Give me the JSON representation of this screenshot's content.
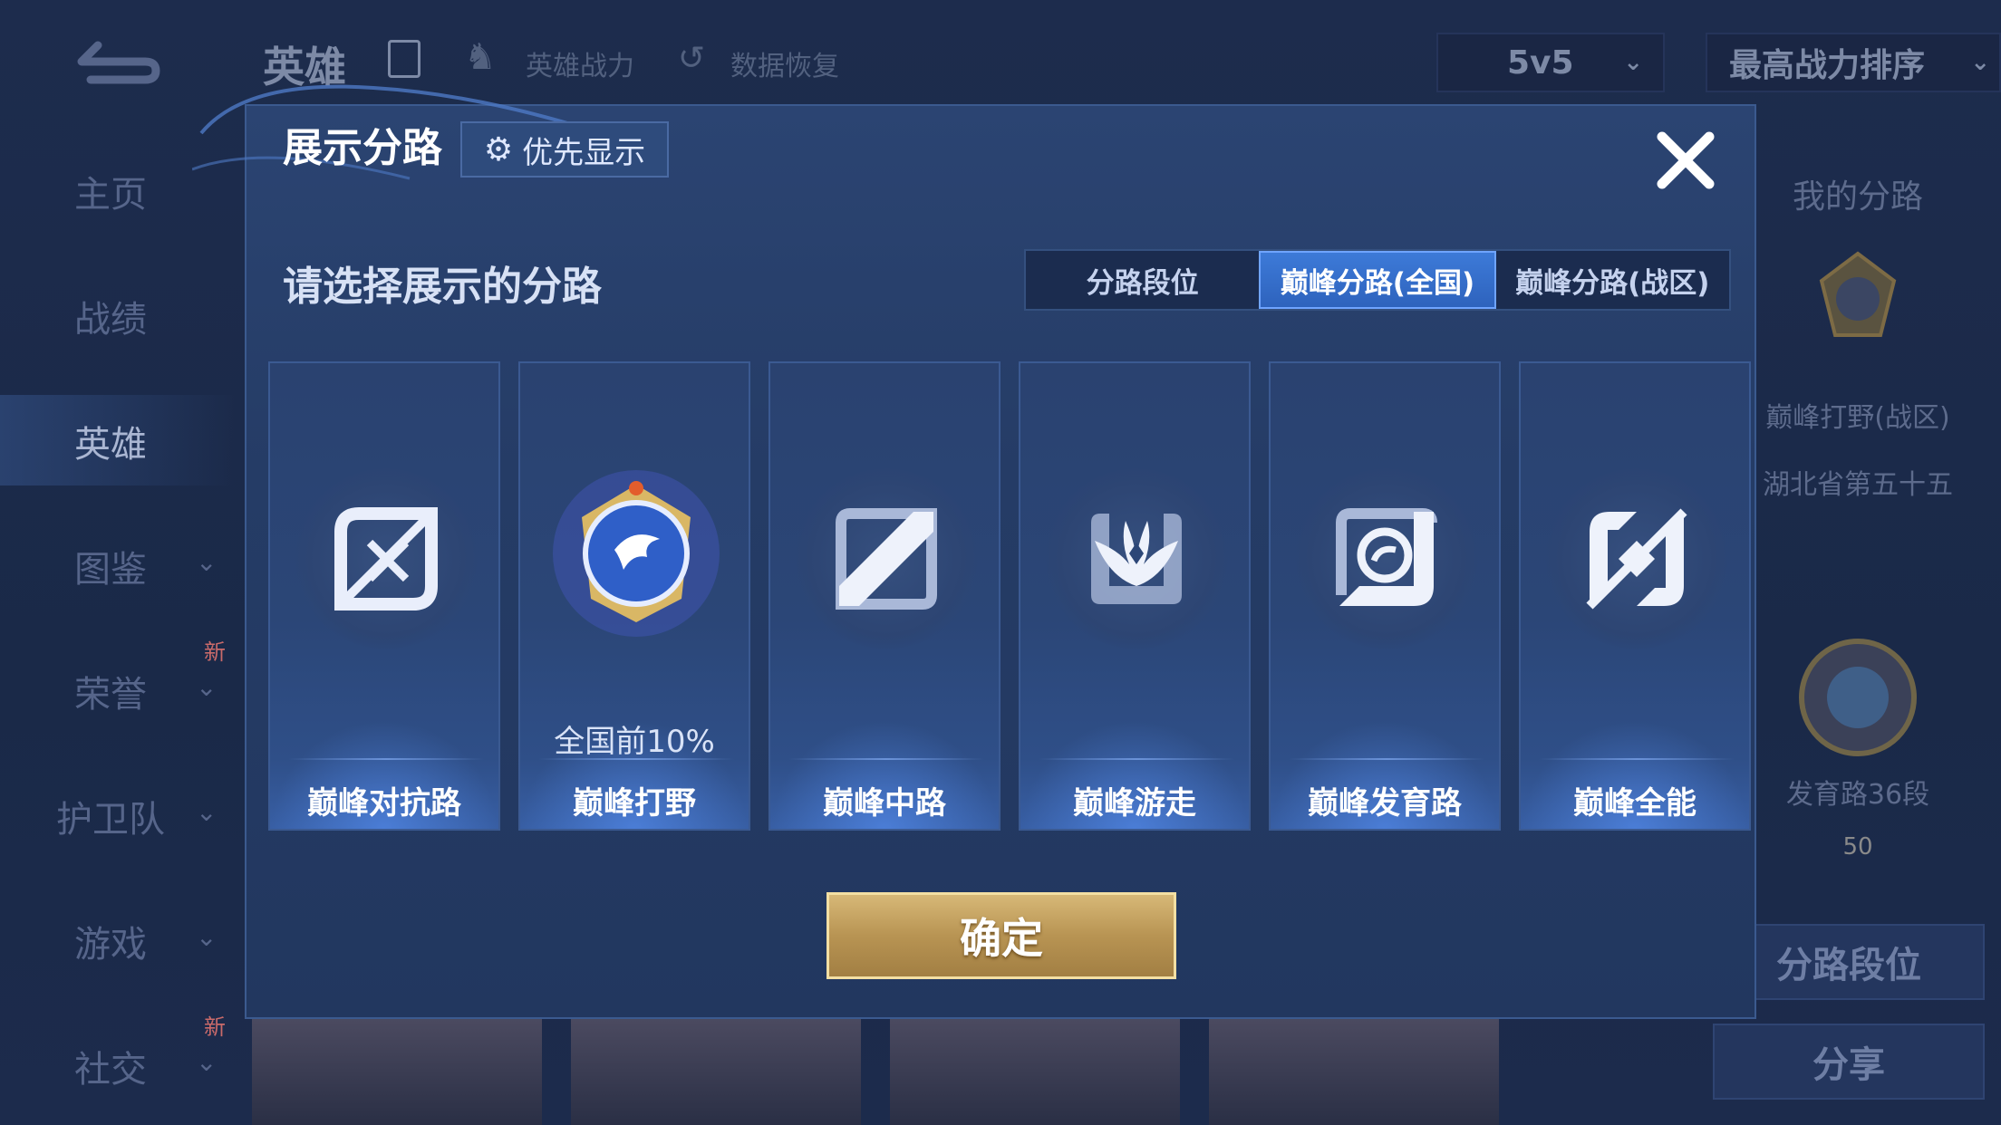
{
  "background": {
    "top_bar": {
      "title": "英雄",
      "links": [
        "英雄战力",
        "数据恢复"
      ],
      "mode_select": "5v5",
      "sort_select": "最高战力排序"
    },
    "side_nav": [
      {
        "label": "主页",
        "active": false,
        "chevron": false,
        "new": false
      },
      {
        "label": "战绩",
        "active": false,
        "chevron": false,
        "new": false
      },
      {
        "label": "英雄",
        "active": true,
        "chevron": false,
        "new": false
      },
      {
        "label": "图鉴",
        "active": false,
        "chevron": true,
        "new": false
      },
      {
        "label": "荣誉",
        "active": false,
        "chevron": true,
        "new": true
      },
      {
        "label": "护卫队",
        "active": false,
        "chevron": true,
        "new": false
      },
      {
        "label": "游戏",
        "active": false,
        "chevron": true,
        "new": false
      },
      {
        "label": "社交",
        "active": false,
        "chevron": true,
        "new": true
      }
    ],
    "new_badge": "新",
    "right_panel": {
      "title": "我的分路",
      "lane_1": "巅峰打野(战区)",
      "lane_1_rank": "湖北省第五十五",
      "lane_2": "发育路36段",
      "level": "50",
      "lane_rank_button": "分路段位",
      "share_button": "分享"
    }
  },
  "modal": {
    "title": "展示分路",
    "priority_button": "优先显示",
    "prompt": "请选择展示的分路",
    "tabs": [
      {
        "label": "分路段位",
        "active": false
      },
      {
        "label": "巅峰分路(全国)",
        "active": true
      },
      {
        "label": "巅峰分路(战区)",
        "active": false
      }
    ],
    "lanes": [
      {
        "label": "巅峰对抗路",
        "icon": "clash-lane-icon",
        "rank": ""
      },
      {
        "label": "巅峰打野",
        "icon": "jungle-dragon-icon",
        "rank": "全国前10%"
      },
      {
        "label": "巅峰中路",
        "icon": "mid-lane-icon",
        "rank": ""
      },
      {
        "label": "巅峰游走",
        "icon": "roam-wings-icon",
        "rank": ""
      },
      {
        "label": "巅峰发育路",
        "icon": "farm-lane-icon",
        "rank": ""
      },
      {
        "label": "巅峰全能",
        "icon": "all-round-icon",
        "rank": ""
      }
    ],
    "confirm_button": "确定"
  },
  "colors": {
    "accent_blue": "#3d7ad8",
    "confirm_gold": "#b89453",
    "modal_bg": "#253c66"
  }
}
